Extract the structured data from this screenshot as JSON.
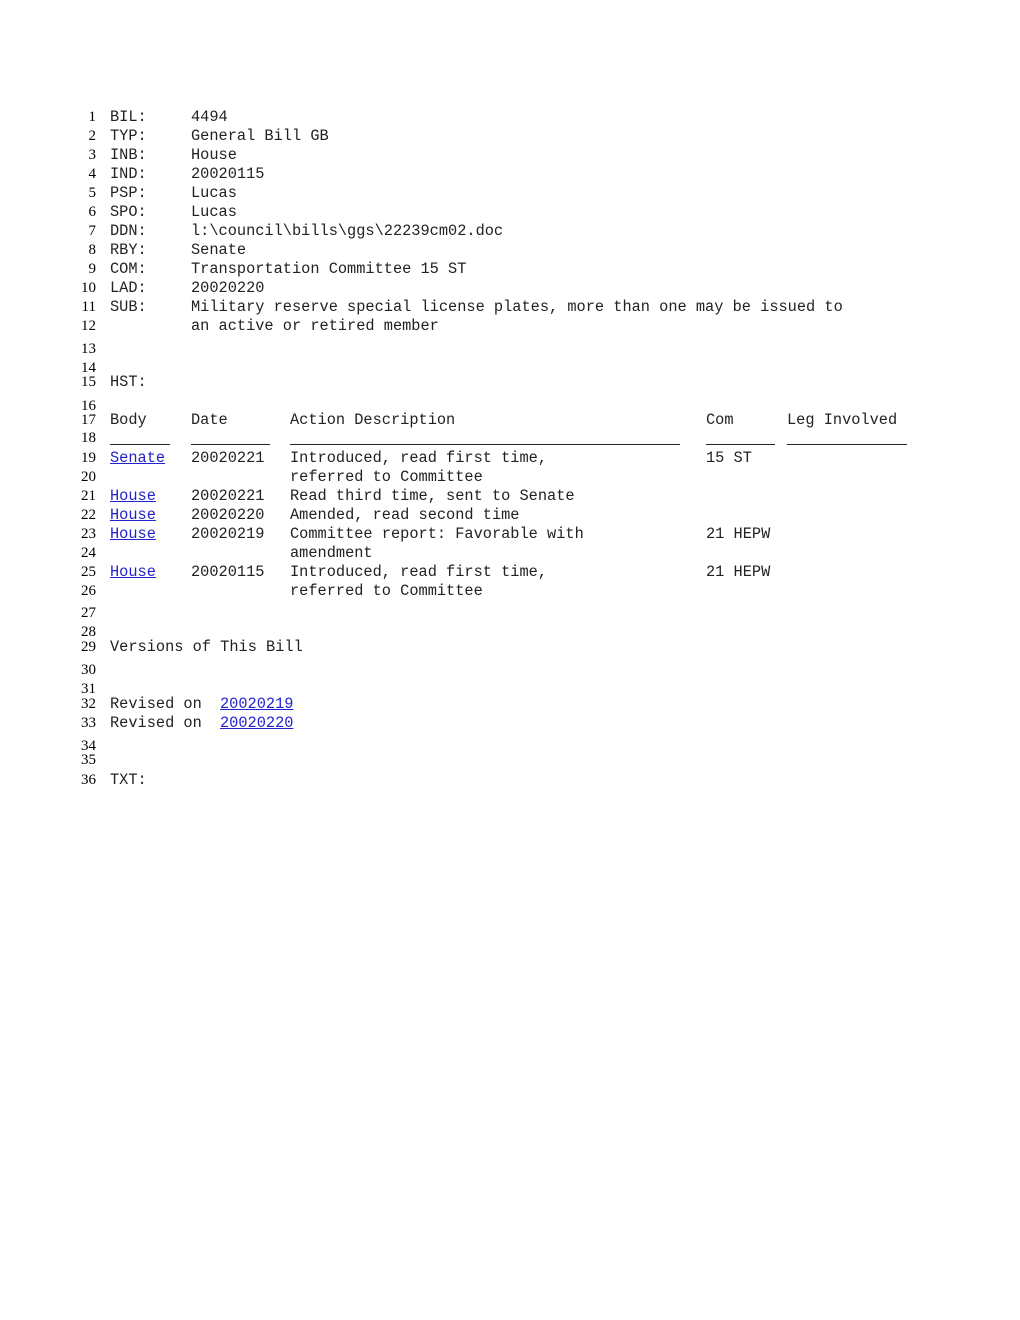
{
  "metadata": {
    "bil": {
      "label": "BIL:",
      "value": "4494"
    },
    "typ": {
      "label": "TYP:",
      "value": "General Bill GB"
    },
    "inb": {
      "label": "INB:",
      "value": "House"
    },
    "ind": {
      "label": "IND:",
      "value": "20020115"
    },
    "psp": {
      "label": "PSP:",
      "value": "Lucas"
    },
    "spo": {
      "label": "SPO:",
      "value": "Lucas"
    },
    "ddn": {
      "label": "DDN:",
      "value": "l:\\council\\bills\\ggs\\22239cm02.doc"
    },
    "rby": {
      "label": "RBY:",
      "value": "Senate"
    },
    "com": {
      "label": "COM:",
      "value": "Transportation Committee 15 ST"
    },
    "lad": {
      "label": "LAD:",
      "value": "20020220"
    },
    "sub": {
      "label": "SUB:",
      "value_line1": "Military reserve special license plates, more than one may be issued to",
      "value_line2": "an active or retired member"
    }
  },
  "history": {
    "label": "HST:",
    "headers": {
      "body": "Body",
      "date": "Date",
      "action": "Action Description",
      "com": "Com",
      "leg": "Leg Involved"
    },
    "rows": [
      {
        "body": "Senate",
        "date": "20020221",
        "action1": "Introduced, read first time,",
        "action2": "referred to Committee",
        "com": "15 ST"
      },
      {
        "body": "House",
        "date": "20020221",
        "action1": "Read third time, sent to Senate",
        "com": ""
      },
      {
        "body": "House",
        "date": "20020220",
        "action1": "Amended, read second time",
        "com": ""
      },
      {
        "body": "House",
        "date": "20020219",
        "action1": "Committee report: Favorable with",
        "action2": "amendment",
        "com": "21 HEPW"
      },
      {
        "body": "House",
        "date": "20020115",
        "action1": "Introduced, read first time,",
        "action2": "referred to Committee",
        "com": "21 HEPW"
      }
    ]
  },
  "versions": {
    "title": "Versions of This Bill",
    "prefix": "Revised on",
    "items": [
      "20020219",
      "20020220"
    ]
  },
  "text_section": {
    "label": "TXT:"
  },
  "line_numbers": [
    "1",
    "2",
    "3",
    "4",
    "5",
    "6",
    "7",
    "8",
    "9",
    "10",
    "11",
    "12",
    "13",
    "14",
    "15",
    "16",
    "17",
    "18",
    "19",
    "20",
    "21",
    "22",
    "23",
    "24",
    "25",
    "26",
    "27",
    "28",
    "29",
    "30",
    "31",
    "32",
    "33",
    "34",
    "35",
    "36"
  ],
  "colors": {
    "link": "#2222cc",
    "text": "#222222"
  }
}
